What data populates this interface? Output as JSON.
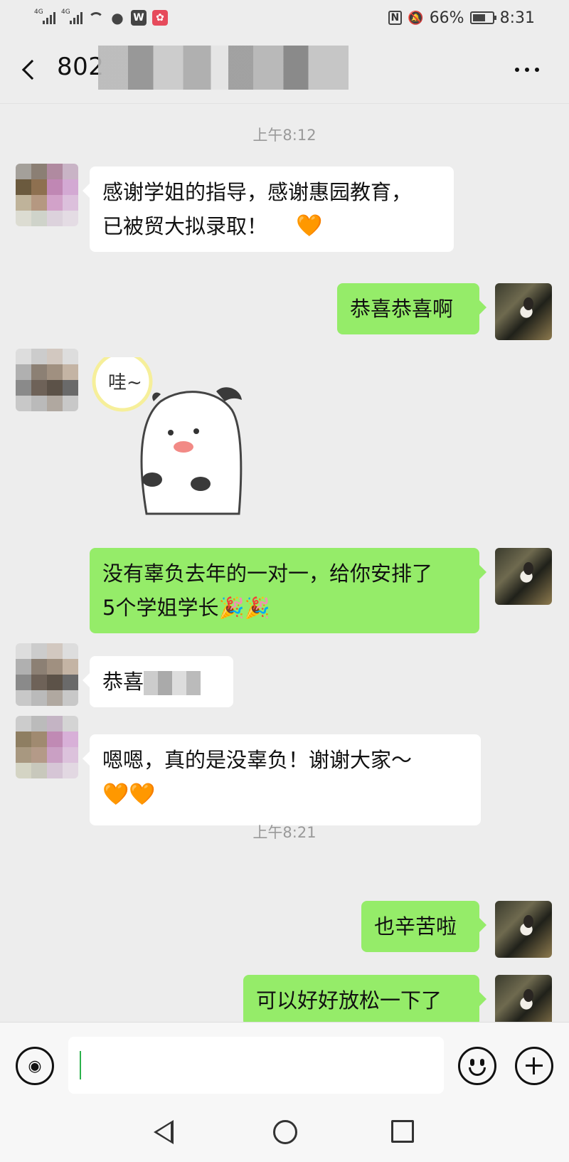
{
  "status_bar": {
    "signal1": "4G",
    "signal2": "4G",
    "battery_percent": "66%",
    "battery_level": 0.66,
    "time": "8:31",
    "icons": [
      "signal-icon",
      "signal-icon",
      "wifi-icon",
      "wechat-icon",
      "wps-icon",
      "huawei-icon",
      "nfc-icon",
      "mute-icon",
      "battery-icon"
    ]
  },
  "header": {
    "title": "802",
    "back_icon": "chevron-left-icon",
    "more_icon": "more-dots-icon"
  },
  "chat": {
    "time1": "上午8:12",
    "time2": "上午8:21",
    "messages": [
      {
        "from": "other",
        "text": "感谢学姐的指导，感谢惠园教育，\n已被贸大拟录取！",
        "heart": "🧡"
      },
      {
        "from": "me",
        "text": "恭喜恭喜啊"
      },
      {
        "from": "other",
        "sticker": "哇~"
      },
      {
        "from": "me",
        "text": "没有辜负去年的一对一，给你安排了\n5个学姐学长🎉🎉"
      },
      {
        "from": "other",
        "text": "恭喜"
      },
      {
        "from": "other",
        "text": "嗯嗯，真的是没辜负！谢谢大家～",
        "hearts": "🧡🧡"
      },
      {
        "from": "me",
        "text": "也辛苦啦"
      },
      {
        "from": "me",
        "text": "可以好好放松一下了"
      }
    ]
  },
  "input_bar": {
    "voice_icon": "voice-icon",
    "emoji_icon": "emoji-icon",
    "plus_icon": "plus-icon"
  },
  "nav_bar": {
    "icons": [
      "nav-back-icon",
      "nav-home-icon",
      "nav-recent-icon"
    ]
  },
  "colors": {
    "background": "#ededed",
    "outgoing_bubble": "#95ec69",
    "incoming_bubble": "#ffffff",
    "caret": "#2bb24c"
  }
}
